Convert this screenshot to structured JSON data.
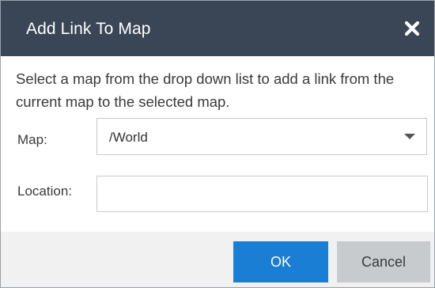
{
  "dialog": {
    "title": "Add Link To Map",
    "close_icon": "close-icon",
    "description": "Select a map from the drop down list to add a link from the current map to the selected map."
  },
  "form": {
    "map_label": "Map:",
    "map_selected": "/World",
    "location_label": "Location:",
    "location_value": "",
    "location_placeholder": ""
  },
  "buttons": {
    "ok_label": "OK",
    "cancel_label": "Cancel"
  },
  "colors": {
    "titlebar": "#3a4556",
    "primary_button": "#1a7ed4",
    "secondary_button": "#c8cbce",
    "footer": "#f1f1f1"
  }
}
